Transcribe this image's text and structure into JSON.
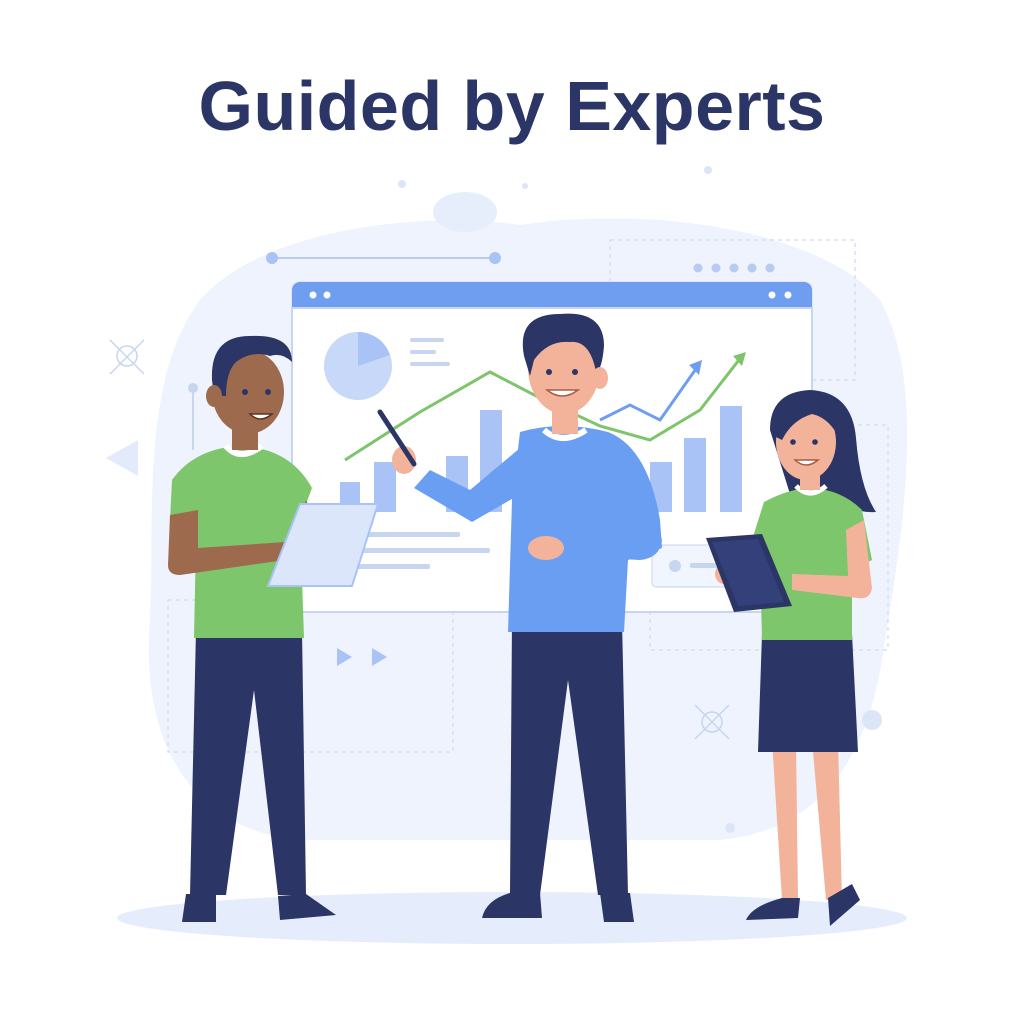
{
  "title": "Guided by Experts",
  "colors": {
    "title": "#2b3566",
    "screen_header": "#6f9ef0",
    "screen_body": "#ffffff",
    "chart_bar": "#a9c3f7",
    "chart_line_green": "#7dc46a",
    "chart_line_blue": "#6f9ef0",
    "shirt_green": "#7dc66b",
    "shirt_blue": "#6a9ef2",
    "pants_navy": "#2b3566",
    "background_blob": "#eef3fd"
  },
  "icons": [
    "presentation-screen",
    "pie-chart-icon",
    "bar-chart-icon",
    "trend-arrow-icon",
    "tablet-icon",
    "pointer-pen-icon",
    "play-icon"
  ]
}
